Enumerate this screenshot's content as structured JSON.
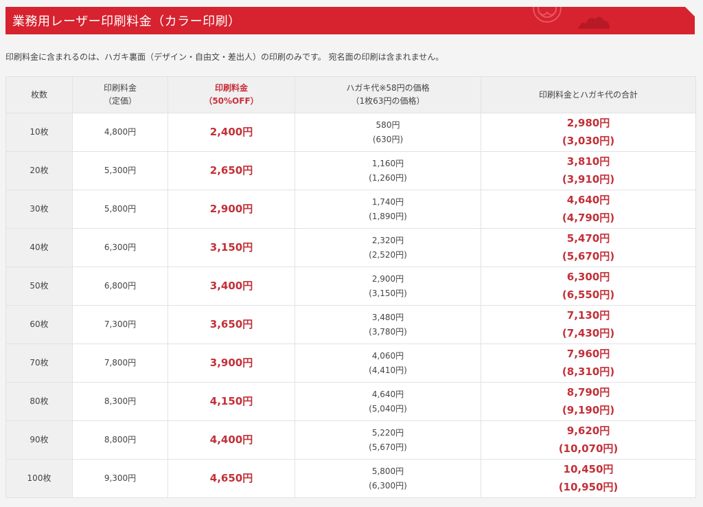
{
  "header": {
    "title": "業務用レーザー印刷料金（カラー印刷）",
    "colors": {
      "accent": "#d7222f",
      "price_red": "#c23038"
    }
  },
  "note": "印刷料金に含まれるのは、ハガキ裏面（デザイン・自由文・差出人）の印刷のみです。 宛名面の印刷は含まれません。",
  "table": {
    "headers": [
      {
        "line1": "枚数",
        "line2": ""
      },
      {
        "line1": "印刷料金",
        "line2": "（定価）"
      },
      {
        "line1": "印刷料金",
        "line2": "（50%OFF）"
      },
      {
        "line1": "ハガキ代※58円の価格",
        "line2": "（1枚63円の価格）"
      },
      {
        "line1": "印刷料金とハガキ代の合計",
        "line2": ""
      }
    ],
    "rows": [
      {
        "count": "10枚",
        "list_price": "4,800円",
        "discount": "2,400円",
        "card_58": "580円",
        "card_63": "(630円)",
        "total_58": "2,980円",
        "total_63": "(3,030円)"
      },
      {
        "count": "20枚",
        "list_price": "5,300円",
        "discount": "2,650円",
        "card_58": "1,160円",
        "card_63": "(1,260円)",
        "total_58": "3,810円",
        "total_63": "(3,910円)"
      },
      {
        "count": "30枚",
        "list_price": "5,800円",
        "discount": "2,900円",
        "card_58": "1,740円",
        "card_63": "(1,890円)",
        "total_58": "4,640円",
        "total_63": "(4,790円)"
      },
      {
        "count": "40枚",
        "list_price": "6,300円",
        "discount": "3,150円",
        "card_58": "2,320円",
        "card_63": "(2,520円)",
        "total_58": "5,470円",
        "total_63": "(5,670円)"
      },
      {
        "count": "50枚",
        "list_price": "6,800円",
        "discount": "3,400円",
        "card_58": "2,900円",
        "card_63": "(3,150円)",
        "total_58": "6,300円",
        "total_63": "(6,550円)"
      },
      {
        "count": "60枚",
        "list_price": "7,300円",
        "discount": "3,650円",
        "card_58": "3,480円",
        "card_63": "(3,780円)",
        "total_58": "7,130円",
        "total_63": "(7,430円)"
      },
      {
        "count": "70枚",
        "list_price": "7,800円",
        "discount": "3,900円",
        "card_58": "4,060円",
        "card_63": "(4,410円)",
        "total_58": "7,960円",
        "total_63": "(8,310円)"
      },
      {
        "count": "80枚",
        "list_price": "8,300円",
        "discount": "4,150円",
        "card_58": "4,640円",
        "card_63": "(5,040円)",
        "total_58": "8,790円",
        "total_63": "(9,190円)"
      },
      {
        "count": "90枚",
        "list_price": "8,800円",
        "discount": "4,400円",
        "card_58": "5,220円",
        "card_63": "(5,670円)",
        "total_58": "9,620円",
        "total_63": "(10,070円)"
      },
      {
        "count": "100枚",
        "list_price": "9,300円",
        "discount": "4,650円",
        "card_58": "5,800円",
        "card_63": "(6,300円)",
        "total_58": "10,450円",
        "total_63": "(10,950円)"
      }
    ]
  }
}
